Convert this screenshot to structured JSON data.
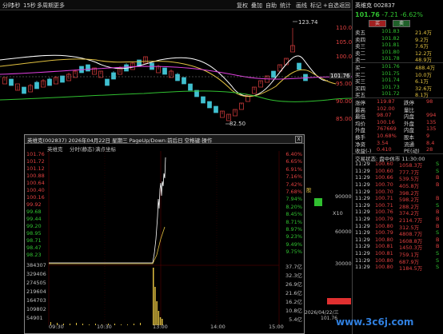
{
  "topbar": {
    "tabs": [
      "5秒",
      "15秒",
      "多周期",
      "更多"
    ],
    "leftlabel": "分时",
    "right_tabs": [
      "复权",
      "叠加",
      "自助",
      "统计",
      "画线",
      "标记",
      "+自选",
      "返回"
    ]
  },
  "kline": {
    "axis_labels": [
      "110.0",
      "105.0",
      "100.0",
      "95.00",
      "90.00",
      "85.00"
    ],
    "high_label": "123.74",
    "low_label": "82.50",
    "current_label": "101.76",
    "colors": {
      "up": "#e04040",
      "down": "#40c0d0",
      "ma1": "#ffffff",
      "ma2": "#e0c040",
      "ma3": "#e040e0",
      "ma4": "#30c030"
    }
  },
  "popup": {
    "title": "英维克(002837) 2026年04月22日 星期三 PageUp/Down:前后日 空格键:操作",
    "sub": [
      "英维克",
      "分时(静态)",
      "满点坐标"
    ],
    "close": "X",
    "price_labels": [
      "101.76",
      "101.72",
      "101.12",
      "100.88",
      "100.64",
      "100.40",
      "100.16",
      "99.92",
      "99.68",
      "99.44",
      "99.20",
      "98.95",
      "98.71",
      "98.47",
      "98.23"
    ],
    "pct_labels": [
      "6.40%",
      "6.65%",
      "6.91%",
      "7.16%",
      "7.42%",
      "7.68%",
      "7.94%",
      "8.20%",
      "8.45%",
      "8.71%",
      "8.97%",
      "9.23%",
      "9.49%",
      "9.75%"
    ],
    "vol_labels": [
      "384307",
      "329406",
      "274505",
      "219604",
      "164703",
      "109802",
      "54901"
    ],
    "vol_pct": [
      "37.7亿",
      "32.3亿",
      "26.9亿",
      "21.6亿",
      "16.2亿",
      "10.8亿",
      "5.4亿"
    ],
    "times": [
      "09:30",
      "10:30",
      "13:00",
      "14:00",
      "15:00"
    ]
  },
  "mid_right": {
    "labels": [
      "股",
      "90000",
      "X10",
      "60000",
      "30000"
    ],
    "date": "2026/04/22/三",
    "price": "101.76"
  },
  "quote": {
    "name": "英维克",
    "code": "002837",
    "price": "101.76",
    "change": "-7.21",
    "pct": "-6.62%",
    "buy_btn": "买",
    "sell_btn": "卖",
    "asks": [
      {
        "label": "卖五",
        "price": "101.83",
        "vol": "21.4万"
      },
      {
        "label": "卖四",
        "price": "101.82",
        "vol": "9.2万"
      },
      {
        "label": "卖三",
        "price": "101.81",
        "vol": "7.6万"
      },
      {
        "label": "卖二",
        "price": "101.80",
        "vol": "12.2万"
      },
      {
        "label": "卖一",
        "price": "101.78",
        "vol": "48.9万"
      }
    ],
    "bids": [
      {
        "label": "买一",
        "price": "101.76",
        "vol": "488.4万"
      },
      {
        "label": "买二",
        "price": "101.75",
        "vol": "10.0万"
      },
      {
        "label": "买三",
        "price": "101.74",
        "vol": "6.1万"
      },
      {
        "label": "买四",
        "price": "101.73",
        "vol": "32.6万"
      },
      {
        "label": "买五",
        "price": "101.72",
        "vol": "8.1万"
      }
    ],
    "stats": [
      {
        "k": "涨停",
        "v": "119.87",
        "k2": "跌停",
        "v2": "98"
      },
      {
        "k": "最高",
        "v": "102.00",
        "k2": "量比",
        "v2": ""
      },
      {
        "k": "最低",
        "v": "98.07",
        "k2": "内盘",
        "v2": "994"
      },
      {
        "k": "均价",
        "v": "100.16",
        "k2": "外盘",
        "v2": "135"
      },
      {
        "k": "外盘",
        "v": "767669",
        "k2": "内盘",
        "v2": "135"
      },
      {
        "k": "换手",
        "v": "10.68%",
        "k2": "股本",
        "v2": "9"
      },
      {
        "k": "净资",
        "v": "3.54",
        "k2": "流通",
        "v2": "8.4"
      },
      {
        "k": "收益(-)",
        "v": "0.410",
        "k2": "PE(动)",
        "v2": "28"
      }
    ],
    "state": "交易状态: 盘中休市 11:30:00",
    "ticks": [
      {
        "t": "11:29",
        "p": "100.60",
        "v": "1058.3万",
        "f": "S"
      },
      {
        "t": "11:29",
        "p": "100.60",
        "v": "777.7万",
        "f": "S"
      },
      {
        "t": "11:29",
        "p": "100.66",
        "v": "539.5万",
        "f": "B"
      },
      {
        "t": "11:29",
        "p": "100.70",
        "v": "405.8万",
        "f": "B"
      },
      {
        "t": "11:29",
        "p": "100.70",
        "v": "398.2万",
        "f": ""
      },
      {
        "t": "11:29",
        "p": "100.71",
        "v": "598.2万",
        "f": "B"
      },
      {
        "t": "11:29",
        "p": "100.71",
        "v": "288.2万",
        "f": "S"
      },
      {
        "t": "11:29",
        "p": "100.76",
        "v": "374.2万",
        "f": "B"
      },
      {
        "t": "11:29",
        "p": "100.79",
        "v": "2114.7万",
        "f": "B"
      },
      {
        "t": "11:29",
        "p": "100.80",
        "v": "312.5万",
        "f": "B"
      },
      {
        "t": "11:29",
        "p": "100.79",
        "v": "4808.7万",
        "f": "S"
      },
      {
        "t": "11:29",
        "p": "100.80",
        "v": "1608.8万",
        "f": "B"
      },
      {
        "t": "11:29",
        "p": "100.81",
        "v": "1450.3万",
        "f": "B"
      },
      {
        "t": "11:29",
        "p": "100.81",
        "v": "759.1万",
        "f": "S"
      },
      {
        "t": "11:29",
        "p": "100.80",
        "v": "687.9万",
        "f": "S"
      },
      {
        "t": "11:29",
        "p": "100.80",
        "v": "1184.5万",
        "f": "S"
      }
    ]
  },
  "watermark": "www.3c6j.com"
}
